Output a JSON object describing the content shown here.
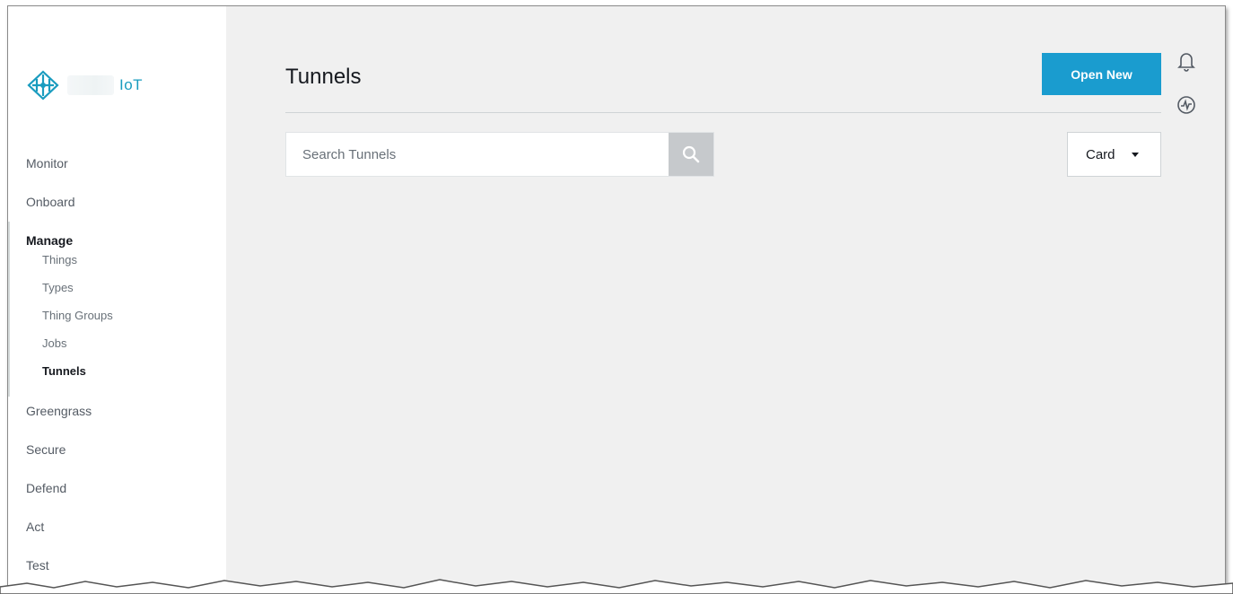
{
  "brand": {
    "name": "IoT"
  },
  "sidebar": {
    "items": [
      {
        "label": "Monitor"
      },
      {
        "label": "Onboard"
      }
    ],
    "manage": {
      "label": "Manage",
      "children": [
        "Things",
        "Types",
        "Thing Groups",
        "Jobs",
        "Tunnels"
      ],
      "active": "Tunnels"
    },
    "items_after": [
      {
        "label": "Greengrass"
      },
      {
        "label": "Secure"
      },
      {
        "label": "Defend"
      },
      {
        "label": "Act"
      },
      {
        "label": "Test"
      }
    ]
  },
  "header": {
    "title": "Tunnels",
    "primary_action": "Open New"
  },
  "search": {
    "placeholder": "Search Tunnels",
    "value": ""
  },
  "view_selector": {
    "selected": "Card"
  },
  "icons": {
    "logo": "iot-logo-icon",
    "search": "search-icon",
    "bell": "notification-bell-icon",
    "pulse": "activity-pulse-icon"
  },
  "colors": {
    "accent": "#1a9ccf",
    "brand_text": "#1a9cbf",
    "background": "#f0f0f0"
  }
}
